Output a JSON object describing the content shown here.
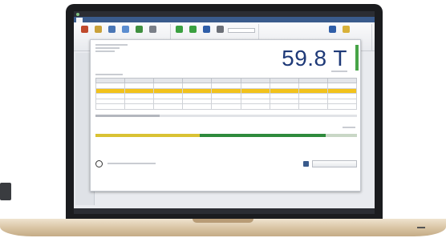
{
  "window": {
    "title": ""
  },
  "tabs": [
    {
      "label": "",
      "active": true
    },
    {
      "label": ""
    },
    {
      "label": ""
    },
    {
      "label": ""
    },
    {
      "label": ""
    }
  ],
  "ribbon": {
    "groups": [
      {
        "name": "",
        "buttons": [
          {
            "label": "",
            "icon": "house-icon",
            "color": "#c04a2d"
          },
          {
            "label": "",
            "icon": "pencil-icon",
            "color": "#c9a13a"
          },
          {
            "label": "",
            "icon": "scale-icon",
            "color": "#4a76b5"
          },
          {
            "label": "",
            "icon": "truck-icon",
            "color": "#5b8dd0"
          },
          {
            "label": "",
            "icon": "save-icon",
            "color": "#3f8f3f"
          },
          {
            "label": "",
            "icon": "clipboard-icon",
            "color": "#7a7f88"
          }
        ]
      },
      {
        "name": "",
        "buttons": [
          {
            "label": "",
            "icon": "cross-icon",
            "color": "#3aa040"
          },
          {
            "label": "",
            "icon": "arrow-icon",
            "color": "#3aa040"
          },
          {
            "label": "",
            "icon": "shield-icon",
            "color": "#2f5ea8"
          },
          {
            "label": "",
            "icon": "gear-icon",
            "color": "#6b6f77"
          }
        ]
      },
      {
        "name": "",
        "buttons": [
          {
            "label": "",
            "icon": "calendar-icon",
            "color": "#2f5ea8"
          },
          {
            "label": "",
            "icon": "pencil-icon",
            "color": "#d8b13a"
          }
        ],
        "input_placeholder": ""
      }
    ]
  },
  "dialog": {
    "big_value": "59.8 T",
    "table": {
      "columns": [
        "",
        "",
        "",
        "",
        "",
        "",
        "",
        "",
        ""
      ],
      "rows": [
        {
          "selected": false,
          "cells": [
            "",
            "",
            "",
            "",
            "",
            "",
            "",
            "",
            ""
          ]
        },
        {
          "selected": true,
          "cells": [
            "",
            "",
            "",
            "",
            "",
            "",
            "",
            "",
            ""
          ]
        },
        {
          "selected": false,
          "cells": [
            "",
            "",
            "",
            "",
            "",
            "",
            "",
            "",
            ""
          ]
        },
        {
          "selected": false,
          "cells": [
            "",
            "",
            "",
            "",
            "",
            "",
            "",
            "",
            ""
          ]
        },
        {
          "selected": false,
          "cells": [
            "",
            "",
            "",
            "",
            "",
            "",
            "",
            "",
            ""
          ]
        }
      ]
    },
    "gauge": {
      "level": 0.88,
      "colors": [
        "#d9c233",
        "#2e8a3c",
        "#c9d7c6"
      ]
    },
    "finish_button_label": ""
  },
  "status": {
    "left": "",
    "right": ""
  }
}
